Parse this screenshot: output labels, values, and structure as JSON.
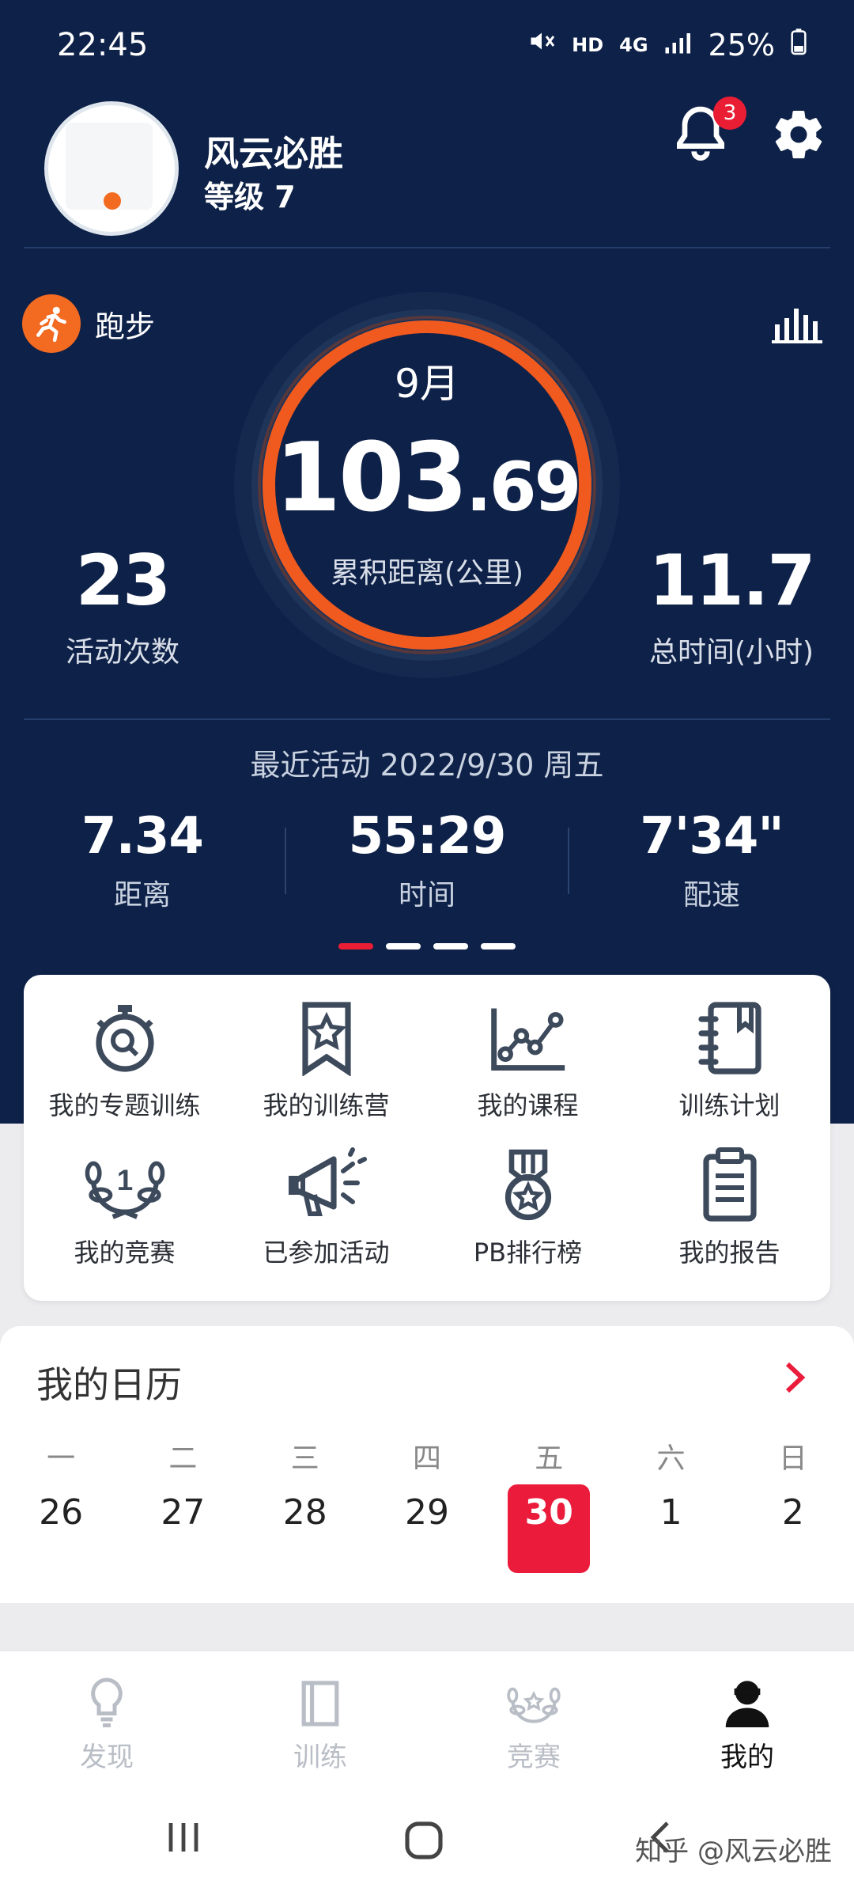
{
  "status_bar": {
    "time": "22:45",
    "network": "HD",
    "signal": "4G",
    "battery": "25%"
  },
  "profile": {
    "username": "风云必胜",
    "level": "等级 7",
    "notification_count": "3"
  },
  "summary": {
    "sport_label": "跑步",
    "month": "9月",
    "distance_int": "103",
    "distance_dec": ".69",
    "distance_label": "累积距离(公里)",
    "activities_value": "23",
    "activities_label": "活动次数",
    "total_time_value": "11.7",
    "total_time_label": "总时间(小时)"
  },
  "recent": {
    "title": "最近活动 2022/9/30 周五",
    "items": [
      {
        "value": "7.34",
        "label": "距离"
      },
      {
        "value": "55:29",
        "label": "时间"
      },
      {
        "value": "7'34\"",
        "label": "配速"
      }
    ],
    "page_dots_total": 4,
    "page_dots_active": 1
  },
  "quick_actions": [
    {
      "label": "我的专题训练",
      "icon": "stopwatch-icon"
    },
    {
      "label": "我的训练营",
      "icon": "bookmark-star-icon"
    },
    {
      "label": "我的课程",
      "icon": "line-chart-icon"
    },
    {
      "label": "训练计划",
      "icon": "notebook-icon"
    },
    {
      "label": "我的竞赛",
      "icon": "laurel-icon"
    },
    {
      "label": "已参加活动",
      "icon": "megaphone-icon"
    },
    {
      "label": "PB排行榜",
      "icon": "medal-icon"
    },
    {
      "label": "我的报告",
      "icon": "clipboard-icon"
    }
  ],
  "calendar": {
    "title": "我的日历",
    "weekdays": [
      "一",
      "二",
      "三",
      "四",
      "五",
      "六",
      "日"
    ],
    "dates": [
      "26",
      "27",
      "28",
      "29",
      "30",
      "1",
      "2"
    ],
    "selected_date": "30"
  },
  "tabs": [
    {
      "label": "发现",
      "icon": "lightbulb-icon"
    },
    {
      "label": "训练",
      "icon": "book-icon"
    },
    {
      "label": "竞赛",
      "icon": "laurel-icon"
    },
    {
      "label": "我的",
      "icon": "user-icon"
    }
  ],
  "active_tab": "我的",
  "watermark": "知乎 @风云必胜",
  "colors": {
    "hero_bg": "#0e2148",
    "accent_orange": "#f36a21",
    "accent_red": "#eb1b3c"
  }
}
